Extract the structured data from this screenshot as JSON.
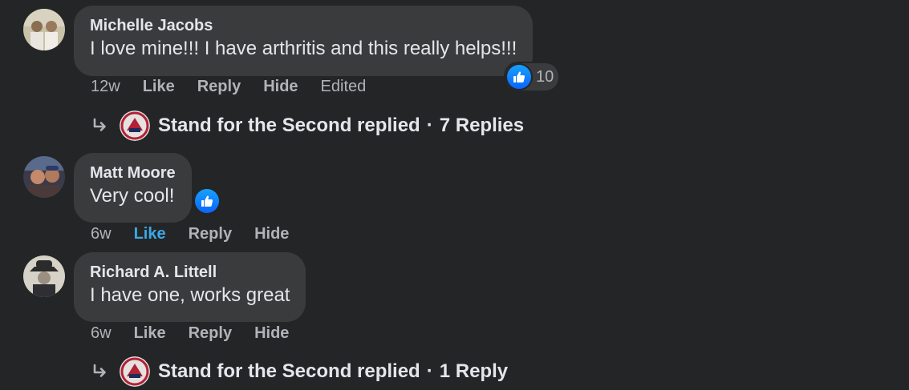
{
  "comments": [
    {
      "author": "Michelle Jacobs",
      "text": "I love mine!!! I have arthritis and this really helps!!!",
      "time": "12w",
      "like_label": "Like",
      "reply_label": "Reply",
      "hide_label": "Hide",
      "edited_label": "Edited",
      "reaction_icon": "like-icon",
      "reaction_count": "10",
      "replied": {
        "name": "Stand for the Second replied",
        "separator": "·",
        "replies": "7 Replies"
      }
    },
    {
      "author": "Matt Moore",
      "text": "Very cool!",
      "time": "6w",
      "like_label": "Like",
      "liked": true,
      "reply_label": "Reply",
      "hide_label": "Hide",
      "reaction_icon": "like-icon"
    },
    {
      "author": "Richard A. Littell",
      "text": "I have one, works great",
      "time": "6w",
      "like_label": "Like",
      "reply_label": "Reply",
      "hide_label": "Hide",
      "replied": {
        "name": "Stand for the Second replied",
        "separator": "·",
        "replies": "1 Reply"
      }
    }
  ],
  "colors": {
    "background": "#242526",
    "bubble": "#3a3b3c",
    "text": "#e4e6eb",
    "secondary": "#b0b3b8",
    "like_accent": "#2d88ff"
  }
}
